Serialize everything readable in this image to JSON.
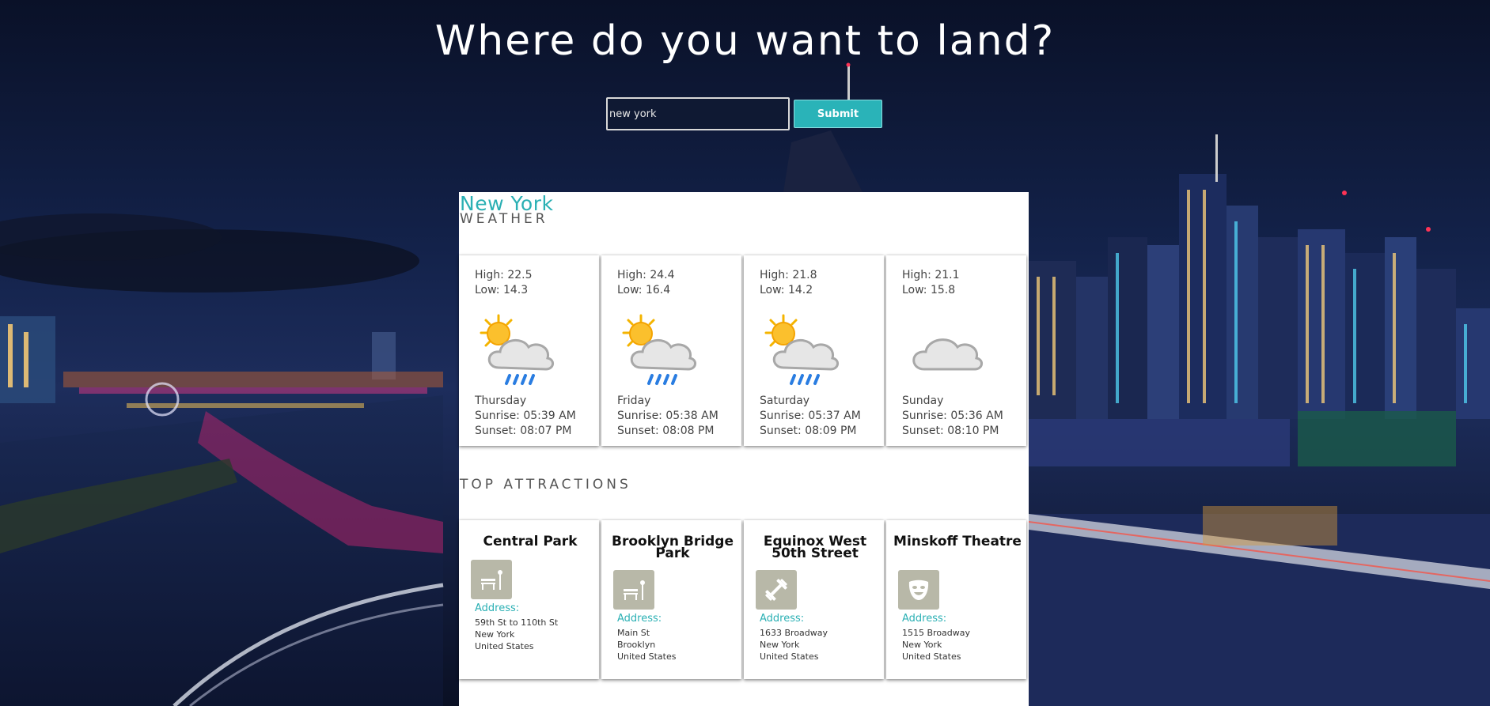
{
  "header": {
    "headline": "Where do you want to land?",
    "search": {
      "value": "new york",
      "placeholder": ""
    },
    "submit_label": "Submit"
  },
  "result": {
    "city": "New York",
    "weather_title": "WEATHER",
    "forecast": [
      {
        "high": "High: 22.5",
        "low": "Low: 14.3",
        "icon": "sun-cloud-rain-icon",
        "day": "Thursday",
        "sunrise": "Sunrise: 05:39 AM",
        "sunset": "Sunset: 08:07 PM"
      },
      {
        "high": "High: 24.4",
        "low": "Low: 16.4",
        "icon": "sun-cloud-rain-icon",
        "day": "Friday",
        "sunrise": "Sunrise: 05:38 AM",
        "sunset": "Sunset: 08:08 PM"
      },
      {
        "high": "High: 21.8",
        "low": "Low: 14.2",
        "icon": "sun-cloud-rain-icon",
        "day": "Saturday",
        "sunrise": "Sunrise: 05:37 AM",
        "sunset": "Sunset: 08:09 PM"
      },
      {
        "high": "High: 21.1",
        "low": "Low: 15.8",
        "icon": "cloud-icon",
        "day": "Sunday",
        "sunrise": "Sunrise: 05:36 AM",
        "sunset": "Sunset: 08:10 PM"
      }
    ],
    "attractions_title": "TOP ATTRACTIONS",
    "attractions": [
      {
        "name": "Central Park",
        "icon": "park-bench-icon",
        "address_label": "Address:",
        "line1": "59th St to 110th St",
        "line2": "New York",
        "line3": "United States"
      },
      {
        "name": "Brooklyn Bridge Park",
        "icon": "park-bench-icon",
        "address_label": "Address:",
        "line1": "Main St",
        "line2": "Brooklyn",
        "line3": "United States"
      },
      {
        "name": "Equinox West 50th Street",
        "icon": "dumbbell-icon",
        "address_label": "Address:",
        "line1": "1633 Broadway",
        "line2": "New York",
        "line3": "United States"
      },
      {
        "name": "Minskoff Theatre",
        "icon": "theater-mask-icon",
        "address_label": "Address:",
        "line1": "1515 Broadway",
        "line2": "New York",
        "line3": "United States"
      }
    ]
  },
  "colors": {
    "accent": "#2bb0b4",
    "button": "#2ab3b8",
    "icon_tile": "#b8b8a8"
  }
}
